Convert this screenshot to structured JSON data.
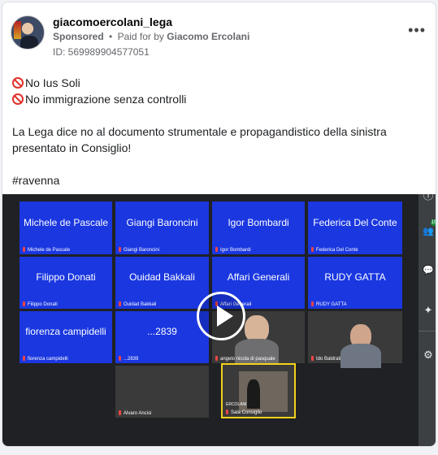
{
  "post": {
    "username": "giacomoercolani_lega",
    "sponsored": "Sponsored",
    "separator": "•",
    "paid_for_prefix": "Paid for by",
    "payer": "Giacomo Ercolani",
    "ad_id": "ID: 569989904577051",
    "more_icon": "more-horizontal-icon",
    "more_label": "•••",
    "lines": [
      "No Ius Soli",
      "No immigrazione senza controlli",
      "La Lega dice no al documento strumentale e propagandistico della sinistra presentato in Consiglio!",
      "#ravenna"
    ]
  },
  "video": {
    "tiles": [
      {
        "name": "Michele de Pascale",
        "label": "Michele de Pascale"
      },
      {
        "name": "Giangi Baroncini",
        "label": "Giangi Baroncini"
      },
      {
        "name": "Igor Bombardi",
        "label": "Igor Bombardi"
      },
      {
        "name": "Federica Del Conte",
        "label": "Federica Del Conte"
      },
      {
        "name": "Filippo Donati",
        "label": "Filippo Donati"
      },
      {
        "name": "Ouidad Bakkali",
        "label": "Ouidad Bakkali"
      },
      {
        "name": "Affari Generali",
        "label": "Affari Generali"
      },
      {
        "name": "RUDY GATTA",
        "label": "RUDY GATTA"
      },
      {
        "name": "fiorenza campidelli",
        "label": "fiorenza campidelli"
      },
      {
        "name": "...2839",
        "label": "...2839"
      },
      {
        "name": "",
        "label": "angelo nicola di pasquale"
      },
      {
        "name": "",
        "label": "Ido Baldrati"
      },
      {
        "name": "",
        "label": "Alvaro Ancisi"
      },
      {
        "name": "",
        "label": "Sala Consiglio"
      }
    ],
    "cam4_caption": "ERCOLANI",
    "rail_icons": [
      "info-icon",
      "participants-icon",
      "chat-icon",
      "activities-icon",
      "settings-icon"
    ],
    "rail_glyphs": [
      "ⓘ",
      "👥",
      "💬",
      "✦",
      "⚙"
    ],
    "participant_badge": "15"
  }
}
